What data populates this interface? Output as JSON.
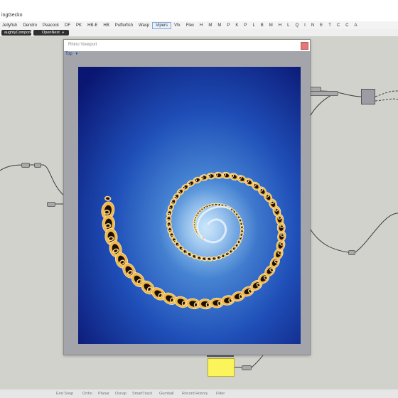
{
  "window": {
    "title": "ingGecko"
  },
  "ribbon": {
    "tabs": [
      "Jellyfish",
      "Dendro",
      "Peacock",
      "DF",
      "PK",
      "HB-E",
      "HB",
      "Pufferfish",
      "Wasp",
      "Vipers",
      "Vfx",
      "Flex",
      "H",
      "M",
      "M",
      "P",
      "K",
      "P",
      "L",
      "B",
      "M",
      "H",
      "L",
      "Q",
      "I",
      "N",
      "E",
      "T",
      "C",
      "C",
      "A"
    ],
    "active_tab": "Vipers"
  },
  "toolbar": {
    "button_1": "aughtyCompone..",
    "button_2": "OpenNest"
  },
  "viewport_window": {
    "title": "Rhino Viewport",
    "view_label": "Top",
    "view_arrow": "▾"
  },
  "taskbar": {
    "items": [
      "End Snap",
      "Ortho",
      "Planar",
      "Osnap",
      "SmartTrack",
      "Gumball",
      "Record History",
      "Filter"
    ]
  },
  "colors": {
    "render_deep": "#0c1a80",
    "render_light": "#7ab4e8",
    "fractal_gold": "#f2b84b",
    "fractal_dark": "#1a0f05",
    "panel_yellow": "#fbf45a"
  }
}
